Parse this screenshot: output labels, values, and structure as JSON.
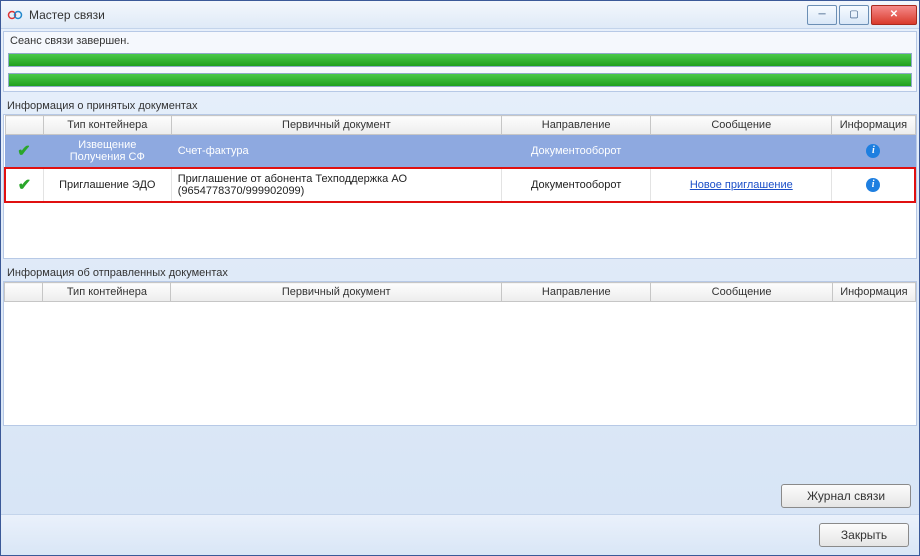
{
  "window": {
    "title": "Мастер связи"
  },
  "status": {
    "text": "Сеанс связи завершен."
  },
  "received": {
    "label": "Информация о принятых документах",
    "columns": [
      "",
      "Тип контейнера",
      "Первичный документ",
      "Направление",
      "Сообщение",
      "Информация"
    ],
    "rows": [
      {
        "type": "Извещение Получения СФ",
        "doc": "Счет-фактура",
        "dir": "Документооборот",
        "msg": "",
        "msg_is_link": false,
        "selected": true,
        "highlight": false
      },
      {
        "type": "Приглашение ЭДО",
        "doc": "Приглашение от абонента Техподдержка АО (9654778370/999902099)",
        "dir": "Документооборот",
        "msg": "Новое приглашение",
        "msg_is_link": true,
        "selected": false,
        "highlight": true
      }
    ]
  },
  "sent": {
    "label": "Информация об отправленных документах",
    "columns": [
      "",
      "Тип контейнера",
      "Первичный документ",
      "Направление",
      "Сообщение",
      "Информация"
    ]
  },
  "buttons": {
    "journal": "Журнал связи",
    "close": "Закрыть"
  }
}
